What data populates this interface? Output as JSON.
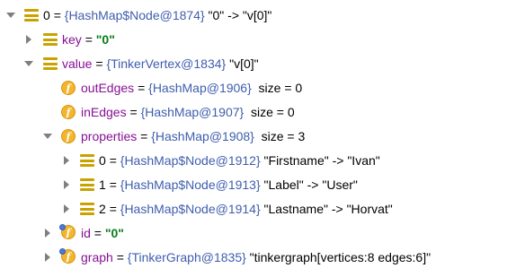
{
  "tree": {
    "rows": [
      {
        "expanded": true,
        "icon": "entry-icon",
        "name": "0",
        "type": "{HashMap$Node@1874}",
        "value": "\"0\" -> \"v[0]\""
      },
      {
        "expanded": false,
        "icon": "entry-icon",
        "name": "key",
        "value": "\"0\""
      },
      {
        "expanded": true,
        "icon": "entry-icon",
        "name": "value",
        "type": "{TinkerVertex@1834}",
        "value": "\"v[0]\""
      },
      {
        "icon": "field-icon",
        "name": "outEdges",
        "type": "{HashMap@1906}",
        "value": "size = 0"
      },
      {
        "icon": "field-icon",
        "name": "inEdges",
        "type": "{HashMap@1907}",
        "value": "size = 0"
      },
      {
        "expanded": true,
        "icon": "field-icon",
        "name": "properties",
        "type": "{HashMap@1908}",
        "value": "size = 3"
      },
      {
        "expanded": false,
        "icon": "entry-icon",
        "name": "0",
        "type": "{HashMap$Node@1912}",
        "value": "\"Firstname\" -> \"Ivan\""
      },
      {
        "expanded": false,
        "icon": "entry-icon",
        "name": "1",
        "type": "{HashMap$Node@1913}",
        "value": "\"Label\" -> \"User\""
      },
      {
        "expanded": false,
        "icon": "entry-icon",
        "name": "2",
        "type": "{HashMap$Node@1914}",
        "value": "\"Lastname\" -> \"Horvat\""
      },
      {
        "expanded": false,
        "icon": "final-field-icon",
        "name": "id",
        "value": "\"0\""
      },
      {
        "expanded": false,
        "icon": "final-field-icon",
        "name": "graph",
        "type": "{TinkerGraph@1835}",
        "value": "\"tinkergraph[vertices:8 edges:6]\""
      }
    ],
    "eq": "=",
    "colors": {
      "name": "#871094",
      "type": "#3e5eae",
      "string_value": "#067d17",
      "entry_icon": "#c9a200",
      "field_icon": "#f3b52c",
      "final_mark": "#4e7bd1",
      "arrow": "#7f7f7f"
    }
  }
}
